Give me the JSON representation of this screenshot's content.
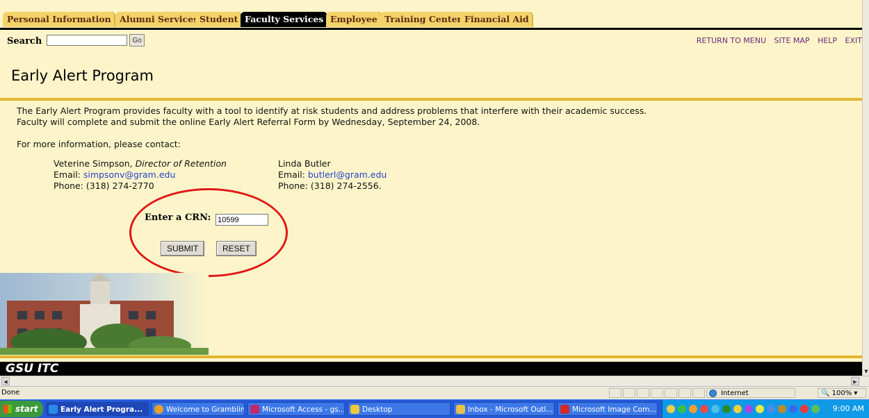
{
  "tabs": [
    {
      "label": "Personal Information",
      "active": false
    },
    {
      "label": "Alumni Services",
      "active": false
    },
    {
      "label": "Student",
      "active": false
    },
    {
      "label": "Faculty Services",
      "active": true
    },
    {
      "label": "Employee",
      "active": false
    },
    {
      "label": "Training Center",
      "active": false
    },
    {
      "label": "Financial Aid",
      "active": false
    }
  ],
  "search": {
    "label": "Search",
    "value": "",
    "go_label": "Go"
  },
  "toplinks": [
    "RETURN TO MENU",
    "SITE MAP",
    "HELP",
    "EXIT"
  ],
  "page": {
    "title": "Early Alert Program",
    "intro_1": "The Early Alert Program provides faculty with a tool to identify at risk students and address problems that interfere with their academic success.",
    "intro_2": "Faculty will complete and submit the online Early Alert Referral Form by Wednesday, September 24, 2008.",
    "contact_prompt": "For more information, please contact:"
  },
  "contacts": [
    {
      "name": "Veterine Simpson, ",
      "title": "Director of Retention",
      "email_label": "Email: ",
      "email": "simpsonv@gram.edu",
      "phone": "Phone: (318) 274-2770"
    },
    {
      "name": "Linda Butler",
      "title": "",
      "email_label": "Email: ",
      "email": "butlerl@gram.edu",
      "phone": "Phone: (318) 274-2556."
    }
  ],
  "form": {
    "crn_label": "Enter a CRN:",
    "crn_value": "10599",
    "submit_label": "SUBMIT",
    "reset_label": "RESET"
  },
  "footer": {
    "text": "GSU ITC"
  },
  "statusbar": {
    "status": "Done",
    "zone": "Internet",
    "zoom": "100%"
  },
  "taskbar": {
    "start_label": "start",
    "tasks": [
      {
        "label": "Early Alert Progra...",
        "active": true
      },
      {
        "label": "Welcome to Gramblin...",
        "active": false
      },
      {
        "label": "Microsoft Access - gs...",
        "active": false
      },
      {
        "label": "Desktop",
        "active": false
      },
      {
        "label": "Inbox - Microsoft Outl...",
        "active": false
      },
      {
        "label": "Microsoft Image Com...",
        "active": false
      }
    ],
    "clock": "9:00 AM"
  },
  "colors": {
    "page_bg": "#fdf5c9",
    "tab_bg": "#f4d36b",
    "rule": "#e3b531",
    "annotation": "#e01818"
  }
}
